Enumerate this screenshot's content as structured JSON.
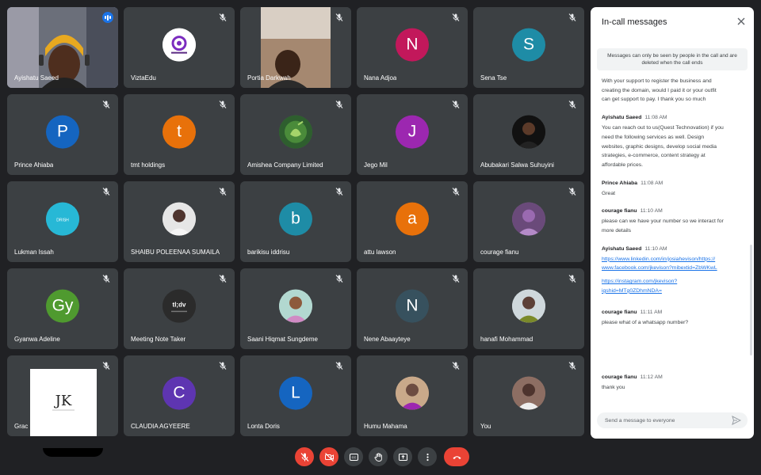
{
  "participants": [
    {
      "name": "Ayishatu Saeed",
      "speaking": true,
      "kind": "video",
      "scene": "ayishatu"
    },
    {
      "name": "ViztaEdu",
      "kind": "logo",
      "avatar_bg": "#ffffff"
    },
    {
      "name": "Portia Darkwah",
      "kind": "video",
      "scene": "portia"
    },
    {
      "name": "Nana Adjoa",
      "kind": "initial",
      "initial": "N",
      "avatar_bg": "#c2185b"
    },
    {
      "name": "Sena Tse",
      "kind": "initial",
      "initial": "S",
      "avatar_bg": "#1e8ca6"
    },
    {
      "name": "Prince Ahiaba",
      "kind": "initial",
      "initial": "P",
      "avatar_bg": "#1565c0"
    },
    {
      "name": "tmt holdings",
      "kind": "initial",
      "initial": "t",
      "avatar_bg": "#e8710a"
    },
    {
      "name": "Amishea Company Limited",
      "kind": "logo",
      "avatar_bg": "#3e7d3e"
    },
    {
      "name": "Jego Mil",
      "kind": "initial",
      "initial": "J",
      "avatar_bg": "#9c27b0"
    },
    {
      "name": "Abubakari Salwa Suhuyini",
      "kind": "photo",
      "avatar_bg": "#111111"
    },
    {
      "name": "Lukman Issah",
      "kind": "logo",
      "avatar_bg": "#27b8d6"
    },
    {
      "name": "SHAIBU POLEENAA SUMAILA",
      "kind": "photo",
      "avatar_bg": "#e6e6e6"
    },
    {
      "name": "barikisu iddrisu",
      "kind": "initial",
      "initial": "b",
      "avatar_bg": "#1e8ca6"
    },
    {
      "name": "attu lawson",
      "kind": "initial",
      "initial": "a",
      "avatar_bg": "#e8710a"
    },
    {
      "name": "courage fianu",
      "kind": "photo",
      "avatar_bg": "#8e6a9a"
    },
    {
      "name": "Gyanwa Adeline",
      "kind": "initial",
      "initial": "Gy",
      "avatar_bg": "#4f9a2f"
    },
    {
      "name": "Meeting Note Taker",
      "kind": "logo",
      "avatar_bg": "#2b2b2b",
      "logo_text": "tl;dv"
    },
    {
      "name": "Saani Hiqmat Sungdeme",
      "kind": "photo",
      "avatar_bg": "#b2d8d0"
    },
    {
      "name": "Nene Abaayteye",
      "kind": "initial",
      "initial": "N",
      "avatar_bg": "#37515e"
    },
    {
      "name": "hanafi Mohammad",
      "kind": "photo",
      "avatar_bg": "#cfd8dc"
    },
    {
      "name": "Grac",
      "kind": "whitebox",
      "logo_text": "JK"
    },
    {
      "name": "CLAUDIA AGYEERE",
      "kind": "initial",
      "initial": "C",
      "avatar_bg": "#5e35b1"
    },
    {
      "name": "Lonta Doris",
      "kind": "initial",
      "initial": "L",
      "avatar_bg": "#1565c0"
    },
    {
      "name": "Humu Mahama",
      "kind": "photo",
      "avatar_bg": "#c9a98a"
    },
    {
      "name": "You",
      "kind": "photo",
      "avatar_bg": "#8d6e63"
    }
  ],
  "panel": {
    "title": "In-call messages",
    "notice": "Messages can only be seen by people in the call and are deleted when the call ends",
    "first_text": [
      "With your support to register the business and",
      "creating the domain, would I paid it or your outfit",
      "can get support to pay. I thank you so much"
    ],
    "messages": [
      {
        "sender": "Ayishatu Saeed",
        "time": "11:08 AM",
        "lines": [
          "You can reach out to us(Quest Technovation) if you",
          "need the following services as well. Design",
          "websites, graphic designs, develop social media",
          "strategies, e-commerce, content strategy at",
          "affordable prices."
        ]
      },
      {
        "sender": "Prince Ahiaba",
        "time": "11:08 AM",
        "lines": [
          "Great"
        ]
      },
      {
        "sender": "courage fianu",
        "time": "11:10 AM",
        "lines": [
          "please can we have your number so we interact for",
          "more details"
        ]
      },
      {
        "sender": "Ayishatu Saeed",
        "time": "11:10 AM",
        "links": [
          "https://www.linkedin.com/in/josiahevison/https://",
          "www.facebook.com/jkevison?mibextid=ZbWKwL",
          "https://instagram.com/jkevison?",
          "igshid=MTg0ZDhmNDA="
        ]
      },
      {
        "sender": "courage fianu",
        "time": "11:11 AM",
        "lines": [
          "please what of a whatsapp number?"
        ]
      },
      {
        "sender": "courage fianu",
        "time": "11:12 AM",
        "lines": [
          "thank you"
        ]
      }
    ],
    "composer_placeholder": "Send a message to everyone"
  },
  "controls": [
    "mic-off",
    "camera-off",
    "captions",
    "raise-hand",
    "present",
    "more-options",
    "leave-call"
  ],
  "colors": {
    "background": "#202124",
    "tile": "#3c4043",
    "accent": "#1a73e8",
    "danger": "#ea4335"
  }
}
